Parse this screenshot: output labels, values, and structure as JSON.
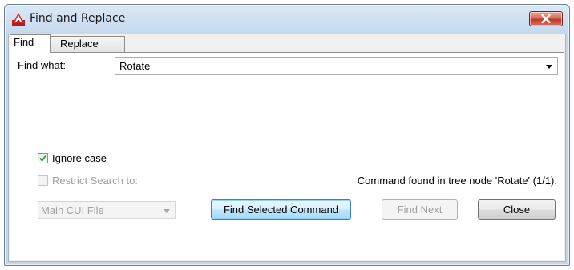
{
  "window": {
    "title": "Find and Replace",
    "app_icon": "autocad-icon",
    "close_icon": "close-icon",
    "close_color": "#c0392b"
  },
  "tabs": [
    {
      "label": "Find",
      "active": true
    },
    {
      "label": "Replace",
      "active": false
    }
  ],
  "find": {
    "label": "Find what:",
    "value": "Rotate"
  },
  "options": {
    "ignore_case": {
      "label": "Ignore case",
      "checked": true,
      "enabled": true
    },
    "restrict_search": {
      "label": "Restrict Search to:",
      "checked": false,
      "enabled": false
    }
  },
  "scope": {
    "selected": "Main CUI File",
    "enabled": false
  },
  "status": "Command found in tree node 'Rotate' (1/1).",
  "buttons": {
    "find_selected": "Find Selected Command",
    "find_next": "Find Next",
    "close": "Close"
  }
}
